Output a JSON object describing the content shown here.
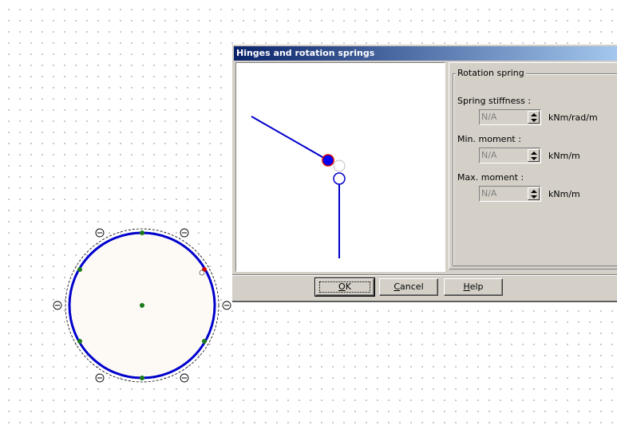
{
  "dialog": {
    "title": "Hinges and rotation springs",
    "group_label": "Rotation spring",
    "fields": [
      {
        "label": "Spring stiffness :",
        "value": "N/A",
        "unit": "kNm/rad/m"
      },
      {
        "label": "Min. moment :",
        "value": "N/A",
        "unit": "kNm/m"
      },
      {
        "label": "Max. moment :",
        "value": "N/A",
        "unit": "kNm/m"
      }
    ],
    "buttons": {
      "ok_mnemonic": "O",
      "ok_rest": "K",
      "cancel_mnemonic": "C",
      "cancel_rest": "ancel",
      "help_mnemonic": "H",
      "help_rest": "elp"
    }
  },
  "colors": {
    "shape_fill": "#fdfaf5",
    "shape_stroke": "#0000cc",
    "node_green": "#1a7a1a",
    "node_selected": "#d40000",
    "preview_line": "#0000cc",
    "hinge_fill": "#0000ff"
  },
  "icons": [
    "minus-circle-icon",
    "spin-up-arrow-icon",
    "spin-down-arrow-icon"
  ]
}
